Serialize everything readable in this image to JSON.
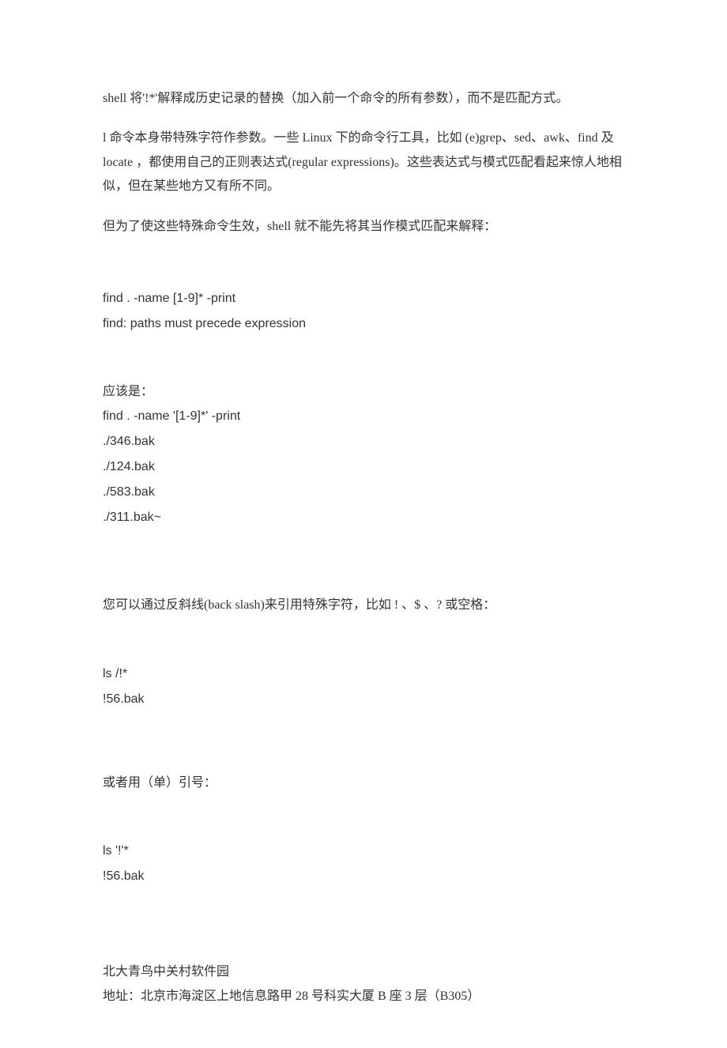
{
  "para1": "shell 将'!*'解释成历史记录的替换（加入前一个命令的所有参数），而不是匹配方式。",
  "para2": "l 命令本身带特殊字符作参数。一些 Linux 下的命令行工具，比如 (e)grep、sed、awk、find 及 locate ，都使用自己的正则表达式(regular expressions)。这些表达式与模式匹配看起来惊人地相似，但在某些地方又有所不同。",
  "para3": "但为了使这些特殊命令生效，shell 就不能先将其当作模式匹配来解释：",
  "code1_line1": "find . -name [1-9]* -print",
  "code1_line2": "find: paths must precede expression",
  "para4": "应该是：",
  "code2_line1": "find . -name '[1-9]*' -print",
  "code2_line2": "./346.bak",
  "code2_line3": "./124.bak",
  "code2_line4": "./583.bak",
  "code2_line5": "./311.bak~",
  "para5": "您可以通过反斜线(back slash)来引用特殊字符，比如 ! 、$ 、? 或空格：",
  "code3_line1": "ls /!*",
  "code3_line2": "!56.bak",
  "para6": "或者用（单）引号：",
  "code4_line1": "ls '!'*",
  "code4_line2": "!56.bak",
  "footer_line1": "北大青鸟中关村软件园",
  "footer_line2": "地址：北京市海淀区上地信息路甲 28 号科实大厦 B 座 3 层（B305）"
}
